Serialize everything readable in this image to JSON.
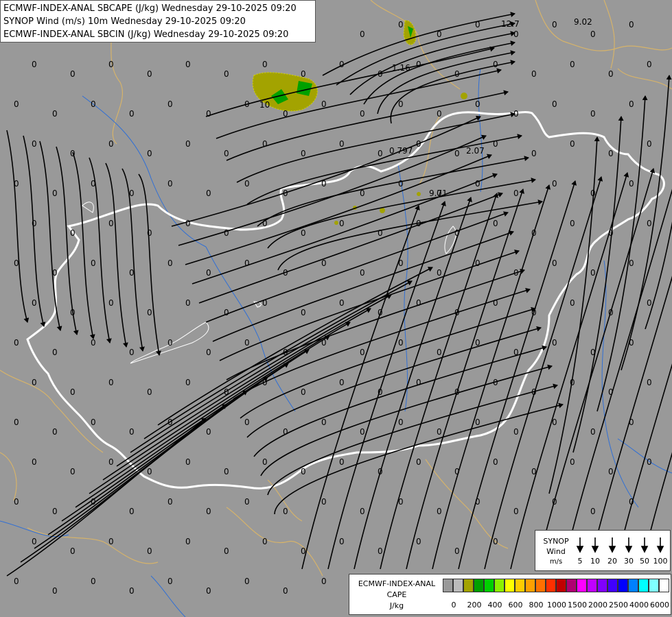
{
  "title_lines": [
    "ECMWF-INDEX-ANAL SBCAPE (J/kg) Wednesday 29-10-2025 09:20",
    "SYNOP Wind (m/s) 10m Wednesday 29-10-2025 09:20",
    "ECMWF-INDEX-ANAL SBCIN (J/kg) Wednesday 29-10-2025 09:20"
  ],
  "colors": {
    "background": "#999999",
    "streamline": "#000000",
    "border_national": "#ffffff",
    "border_regional": "#d6b36a",
    "river": "#2f6fd6",
    "cape_low": "#a3a300",
    "cape_mid": "#00a000"
  },
  "synop_legend": {
    "title": [
      "SYNOP",
      "Wind",
      "m/s"
    ],
    "values": [
      "5",
      "10",
      "20",
      "30",
      "50",
      "100"
    ]
  },
  "cape_legend": {
    "title": [
      "ECMWF-INDEX-ANAL",
      "CAPE",
      "J/kg"
    ],
    "swatch_colors": [
      "#999999",
      "#bbbbbb",
      "#a3a300",
      "#00a000",
      "#00d000",
      "#8cf000",
      "#ffff00",
      "#ffcc00",
      "#ffa000",
      "#ff7000",
      "#ff3000",
      "#c00000",
      "#b00070",
      "#ff00ff",
      "#c000ff",
      "#8000ff",
      "#4000ff",
      "#0000ff",
      "#0080ff",
      "#00ffff",
      "#80ffff",
      "#ffffff"
    ],
    "tick_labels": [
      "0",
      "200",
      "400",
      "600",
      "800",
      "1000",
      "1500",
      "2000",
      "2500",
      "4000",
      "6000"
    ]
  },
  "value_labels": [
    "0",
    "12.7",
    "9.02",
    "1.16",
    "0.797",
    "2.07",
    "9.71",
    "10"
  ]
}
